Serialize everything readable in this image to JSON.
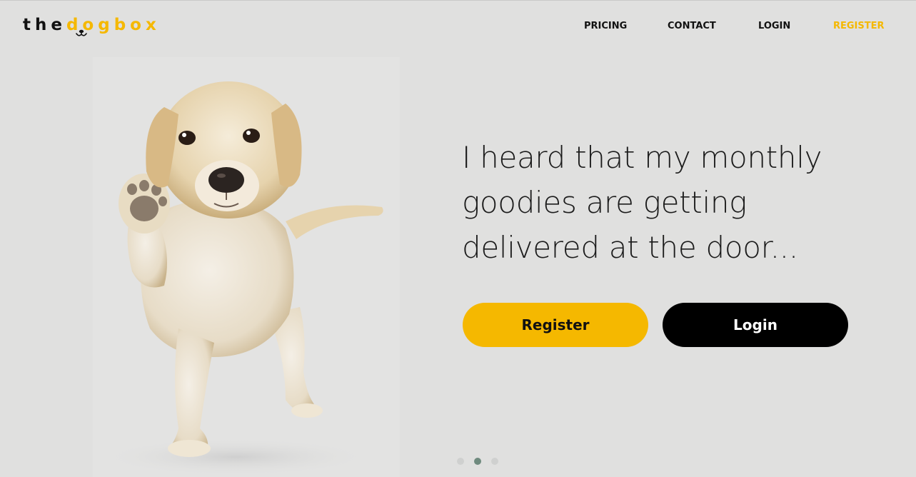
{
  "brand": {
    "logo_the": "the",
    "logo_dog": "dog",
    "logo_box": "box"
  },
  "nav": {
    "items": [
      {
        "label": "PRICING",
        "active": false
      },
      {
        "label": "CONTACT",
        "active": false
      },
      {
        "label": "LOGIN",
        "active": false
      },
      {
        "label": "REGISTER",
        "active": true
      }
    ]
  },
  "hero": {
    "headline": "I heard that my monthly goodies are getting delivered at the door...",
    "register_label": "Register",
    "login_label": "Login",
    "image_icon": "puppy-photo"
  },
  "carousel": {
    "slide_count": 3,
    "active_index": 1
  },
  "colors": {
    "accent": "#f5b800",
    "background": "#e0e0df",
    "text": "#111111",
    "login_button": "#000000",
    "active_dot": "#6f8a7e"
  }
}
